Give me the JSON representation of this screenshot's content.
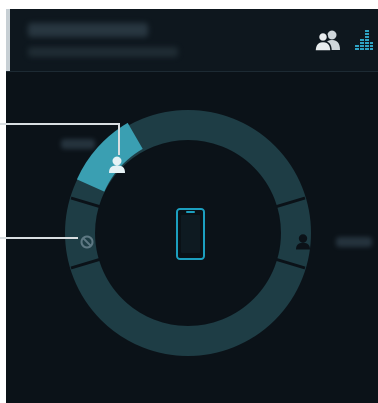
{
  "header": {
    "contacts_icon": "contacts-icon",
    "equalizer_icon": "equalizer-icon"
  },
  "wheel": {
    "center_icon": "phone-icon",
    "segments": [
      {
        "icon": "person-icon",
        "selected": true
      },
      {
        "icon": "blocked-icon",
        "selected": false
      },
      {
        "icon": "person-icon",
        "selected": false
      }
    ]
  },
  "colors": {
    "background": "#0b1218",
    "ring": "#1e3d45",
    "selected_segment": "#3a9fb2",
    "accent": "#1c9fbf"
  }
}
